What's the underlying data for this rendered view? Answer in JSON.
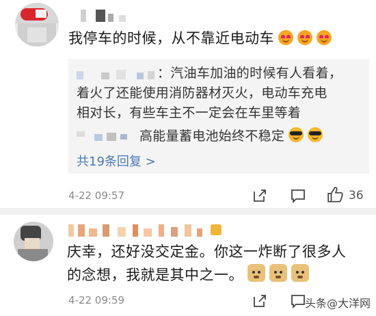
{
  "comments": [
    {
      "text": "我停车的时候，从不靠近电动车",
      "reply_lines": [
        "：汽油车加油的时候有人看着，",
        "着火了还能使用消防器材灭火，电动车充电",
        "相对长，有些车主不一定会在车里等着",
        "高能量蓄电池始终不稳定"
      ],
      "more_replies": "共19条回复 >",
      "time": "4-22 09:57",
      "likes": "36"
    },
    {
      "text_line1": "庆幸，还好没交定金。你这一炸断了很多人",
      "text_line2": "的念想，我就是其中之一。",
      "time": "4-22 09:59"
    }
  ],
  "watermark": "头条@大洋网",
  "icons": {
    "share": "share-icon",
    "comment": "comment-icon",
    "like": "thumbs-up-icon",
    "emoji_love": "heart-eyes-emoji",
    "emoji_cool": "sunglasses-emoji",
    "emoji_dog": "doge-emoji"
  },
  "colors": {
    "link": "#4a78b8",
    "meta": "#8a8a8a",
    "reply_bg": "#f4f4f4"
  }
}
